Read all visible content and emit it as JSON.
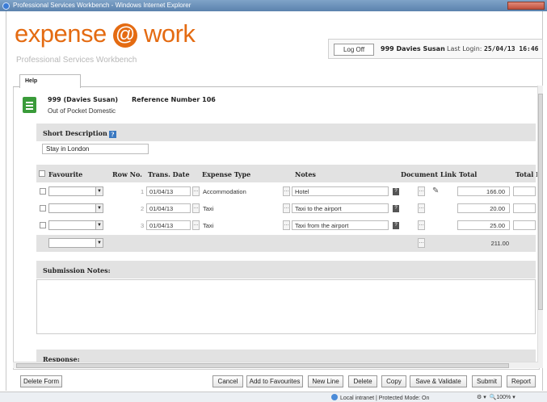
{
  "window": {
    "title": "Professional Services Workbench - Windows Internet Explorer"
  },
  "brand": {
    "logo_left": "expense",
    "logo_at": "@",
    "logo_right": "work",
    "subtitle": "Professional Services Workbench"
  },
  "header": {
    "logoff_label": "Log Off",
    "user": "999 Davies Susan",
    "last_login_label": "Last Login:",
    "last_login_value": "25/04/13 16:46"
  },
  "tabs": [
    {
      "label": "Help"
    }
  ],
  "claim": {
    "title": "999 (Davies Susan)",
    "reference_label": "Reference Number 106",
    "type": "Out of Pocket Domestic"
  },
  "short_description": {
    "label": "Short Description",
    "value": "Stay in London"
  },
  "grid": {
    "headers": {
      "favourite": "Favourite",
      "row_no": "Row No.",
      "trans_date": "Trans. Date",
      "expense_type": "Expense Type",
      "notes": "Notes",
      "document_link": "Document Link",
      "total": "Total",
      "total2": "Total I"
    },
    "rows": [
      {
        "row_no": "1",
        "date": "01/04/13",
        "expense_type": "Accommodation",
        "notes": "Hotel",
        "total": "166.00"
      },
      {
        "row_no": "2",
        "date": "01/04/13",
        "expense_type": "Taxi",
        "notes": "Taxi to the airport",
        "total": "20.00"
      },
      {
        "row_no": "3",
        "date": "01/04/13",
        "expense_type": "Taxi",
        "notes": "Taxi from the airport",
        "total": "25.00"
      }
    ],
    "grand_total": "211.00"
  },
  "sections": {
    "submission_notes": "Submission Notes:",
    "response": "Response:"
  },
  "buttons": {
    "delete_form": "Delete Form",
    "cancel": "Cancel",
    "add_to_favourites": "Add to Favourites",
    "new_line": "New Line",
    "delete": "Delete",
    "copy": "Copy",
    "save_validate": "Save & Validate",
    "submit": "Submit",
    "report": "Report"
  },
  "status": {
    "zone": "Local intranet | Protected Mode: On",
    "zoom": "100%"
  }
}
